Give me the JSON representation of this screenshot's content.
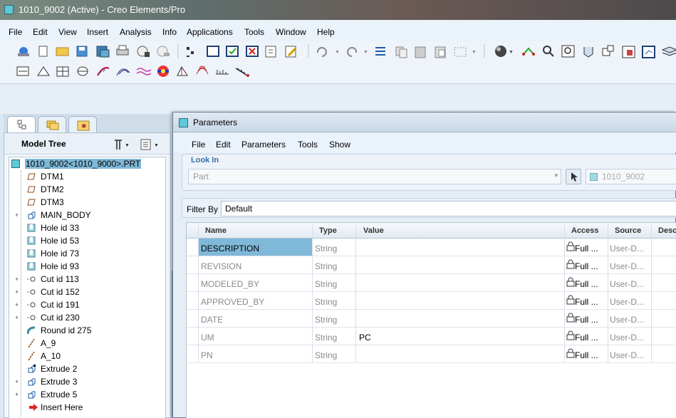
{
  "window": {
    "title": "1010_9002 (Active) - Creo Elements/Pro"
  },
  "menubar": [
    "File",
    "Edit",
    "View",
    "Insert",
    "Analysis",
    "Info",
    "Applications",
    "Tools",
    "Window",
    "Help"
  ],
  "toolbar": {
    "row1_icons": [
      "new-session-icon",
      "new-icon",
      "open-icon",
      "save-icon",
      "save-copy-icon",
      "print-icon",
      "email-icon",
      "email-link-icon",
      "datum-display-icon",
      "window-icon",
      "activate-icon",
      "close-window-icon",
      "regenerate-icon",
      "regen-manager-icon",
      "undo-icon",
      "redo-icon",
      "reorder-icon",
      "copy-icon",
      "paste-icon",
      "paste-special-icon",
      "select-box-icon",
      "shade-icon",
      "orient-icon",
      "zoom-in-icon",
      "zoom-fit-icon",
      "model-display-icon",
      "annotation-icon",
      "views-icon",
      "saved-view-icon",
      "layers-icon"
    ],
    "row2_icons": [
      "measure-distance-icon",
      "measure-angle-icon",
      "mass-properties-icon",
      "section-icon",
      "curvature-icon",
      "shade-analysis-icon",
      "offset-analysis-icon",
      "draft-analysis-icon",
      "dihedral-icon",
      "reflection-icon",
      "slope-icon",
      "ruler-icon"
    ]
  },
  "nav_tabs": [
    "model-tree-tab",
    "folder-browser-tab",
    "favorites-tab"
  ],
  "model_tree": {
    "title": "Model Tree",
    "items": [
      {
        "label": "1010_9002<1010_9000>.PRT",
        "icon": "part-icon",
        "expand": false,
        "selected": true
      },
      {
        "label": "DTM1",
        "icon": "datum-plane-icon",
        "expand": false
      },
      {
        "label": "DTM2",
        "icon": "datum-plane-icon",
        "expand": false
      },
      {
        "label": "DTM3",
        "icon": "datum-plane-icon",
        "expand": false
      },
      {
        "label": "MAIN_BODY",
        "icon": "extrude-icon",
        "expand": true
      },
      {
        "label": "Hole id 33",
        "icon": "hole-icon",
        "expand": false
      },
      {
        "label": "Hole id 53",
        "icon": "hole-icon",
        "expand": false
      },
      {
        "label": "Hole id 73",
        "icon": "hole-icon",
        "expand": false
      },
      {
        "label": "Hole id 93",
        "icon": "hole-icon",
        "expand": false
      },
      {
        "label": "Cut id 113",
        "icon": "cut-icon",
        "expand": true
      },
      {
        "label": "Cut id 152",
        "icon": "cut-icon",
        "expand": true
      },
      {
        "label": "Cut id 191",
        "icon": "cut-icon",
        "expand": true
      },
      {
        "label": "Cut id 230",
        "icon": "cut-icon",
        "expand": true
      },
      {
        "label": "Round id 275",
        "icon": "round-icon",
        "expand": false
      },
      {
        "label": "A_9",
        "icon": "datum-axis-icon",
        "expand": false
      },
      {
        "label": "A_10",
        "icon": "datum-axis-icon",
        "expand": false
      },
      {
        "label": "Extrude 2",
        "icon": "extrude-icon",
        "expand": false
      },
      {
        "label": "Extrude 3",
        "icon": "extrude-icon",
        "expand": true
      },
      {
        "label": "Extrude 5",
        "icon": "extrude-icon",
        "expand": true
      },
      {
        "label": "Insert Here",
        "icon": "insert-here-icon",
        "expand": false
      }
    ]
  },
  "dialog": {
    "title": "Parameters",
    "menu": [
      "File",
      "Edit",
      "Parameters",
      "Tools",
      "Show"
    ],
    "look_in": {
      "legend": "Look In",
      "scope": "Part",
      "model": "1010_9002"
    },
    "filter": {
      "label": "Filter By",
      "value": "Default"
    },
    "columns": [
      "Name",
      "Type",
      "Value",
      "Access",
      "Source",
      "Desc"
    ],
    "rows": [
      {
        "name": "DESCRIPTION",
        "type": "String",
        "value": "",
        "access": "Full ...",
        "source": "User-D..."
      },
      {
        "name": "REVISION",
        "type": "String",
        "value": "",
        "access": "Full ...",
        "source": "User-D..."
      },
      {
        "name": "MODELED_BY",
        "type": "String",
        "value": "",
        "access": "Full ...",
        "source": "User-D..."
      },
      {
        "name": "APPROVED_BY",
        "type": "String",
        "value": "",
        "access": "Full ...",
        "source": "User-D..."
      },
      {
        "name": "DATE",
        "type": "String",
        "value": "",
        "access": "Full ...",
        "source": "User-D..."
      },
      {
        "name": "UM",
        "type": "String",
        "value": "PC",
        "access": "Full ...",
        "source": "User-D..."
      },
      {
        "name": "PN",
        "type": "String",
        "value": "",
        "access": "Full ...",
        "source": "User-D..."
      }
    ]
  }
}
